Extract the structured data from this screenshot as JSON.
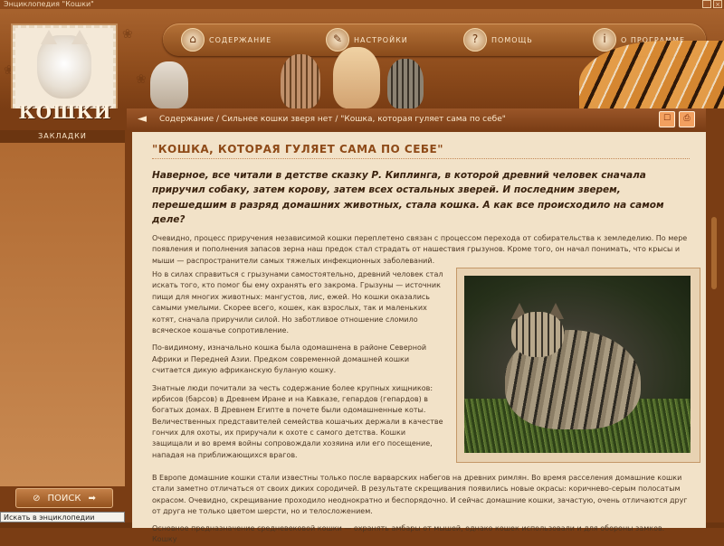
{
  "window": {
    "title": "Энциклопедия \"Кошки\""
  },
  "logo": {
    "text": "КОШКИ"
  },
  "menu": [
    {
      "label": "СОДЕРЖАНИЕ",
      "icon": "home-icon",
      "glyph": "⌂"
    },
    {
      "label": "НАСТРОЙКИ",
      "icon": "wrench-icon",
      "glyph": "✎"
    },
    {
      "label": "ПОМОЩЬ",
      "icon": "help-icon",
      "glyph": "?"
    },
    {
      "label": "О ПРОГРАММЕ",
      "icon": "info-icon",
      "glyph": "i"
    }
  ],
  "nav": {
    "back_glyph": "◄",
    "breadcrumb": "Содержание / Сильнее кошки зверя нет / \"Кошка, которая гуляет сама по себе\"",
    "icons": [
      "☐",
      "⎙"
    ]
  },
  "sidebar": {
    "tab": "ЗАКЛАДКИ"
  },
  "search": {
    "label": "ПОИСК",
    "icon": "⊘",
    "arrow": "➡"
  },
  "status": {
    "text": "Искать в энциклопедии"
  },
  "article": {
    "title": "\"КОШКА, КОТОРАЯ ГУЛЯЕТ САМА ПО СЕБЕ\"",
    "lead": "Наверное, все читали в детстве сказку Р. Киплинга, в которой древний человек сначала приручил собаку, затем корову, затем всех остальных зверей. И последним зверем, перешедшим в разряд домашних животных, стала кошка. А как все происходило на самом деле?",
    "p1": "Очевидно, процесс приручения независимой кошки переплетено связан с процессом перехода от собирательства к земледелию. По мере появления и пополнения запасов зерна наш предок стал страдать от нашествия грызунов. Кроме того, он начал понимать, что крысы и мыши — распространители самых тяжелых инфекционных заболеваний.",
    "p2": "Но в силах справиться с грызунами самостоятельно, древний человек стал искать того, кто помог бы ему охранять его закрома. Грызуны — источник пищи для многих животных: мангустов, лис, ежей. Но кошки оказались самыми умелыми. Скорее всего, кошек, как взрослых, так и маленьких котят, сначала приручили силой. Но заботливое отношение сломило всяческое кошачье сопротивление.",
    "p3": "По-видимому, изначально кошка была одомашнена в районе Северной Африки и Передней Азии. Предком современной домашней кошки считается дикую африканскую буланую кошку.",
    "p4": "Знатные люди почитали за честь содержание более крупных хищников: ирбисов (барсов) в Древнем Иране и на Кавказе, гепардов (гепардов) в богатых домах. В Древнем Египте в почете были одомашненные коты. Величественных представителей семейства кошачьих держали в качестве гончих для охоты, их приручали к охоте с самого детства. Кошки защищали и во время войны сопровождали хозяина или его посещение, нападая на приближающихся врагов.",
    "p5": "В Европе домашние кошки стали известны только после варварских набегов на древних римлян. Во время расселения домашние кошки стали заметно отличаться от своих диких сородичей. В результате скрещивания появились новые окрасы: коричнево-серым полосатым окрасом. Очевидно, скрещивание проходило неоднократно и беспорядочно. И сейчас домашние кошки, зачастую, очень отличаются друг от друга не только цветом шерсти, но и телосложением.",
    "p6": "Основное предназначение средневековой кошки — охранять амбары от мышей, однако кошек использовали и для обороны замков. Кошку"
  },
  "colors": {
    "accent": "#8e4a18",
    "page_bg": "#f2e2c8",
    "frame": "#7a3d14"
  }
}
